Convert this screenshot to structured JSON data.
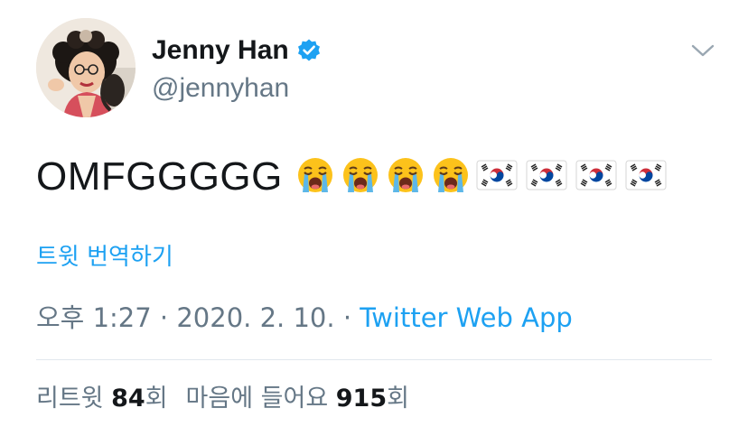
{
  "author": {
    "display_name": "Jenny Han",
    "handle": "@jennyhan",
    "verified": true,
    "verified_color": "#1da1f2"
  },
  "tweet": {
    "text": "OMFGGGGG",
    "emojis": [
      "loudly-crying-face",
      "loudly-crying-face",
      "loudly-crying-face",
      "loudly-crying-face",
      "south-korea-flag",
      "south-korea-flag",
      "south-korea-flag",
      "south-korea-flag"
    ]
  },
  "translate_label": "트윗 번역하기",
  "meta": {
    "time": "오후 1:27",
    "separator": "·",
    "date": "2020. 2. 10.",
    "source": "Twitter Web App"
  },
  "stats": {
    "retweets_label": "리트윗",
    "retweets_count": "84",
    "retweets_suffix": "회",
    "likes_label": "마음에 들어요",
    "likes_count": "915",
    "likes_suffix": "회"
  },
  "colors": {
    "link": "#1da1f2",
    "secondary_text": "#657786",
    "primary_text": "#14171a",
    "divider": "#e1e8ed"
  }
}
